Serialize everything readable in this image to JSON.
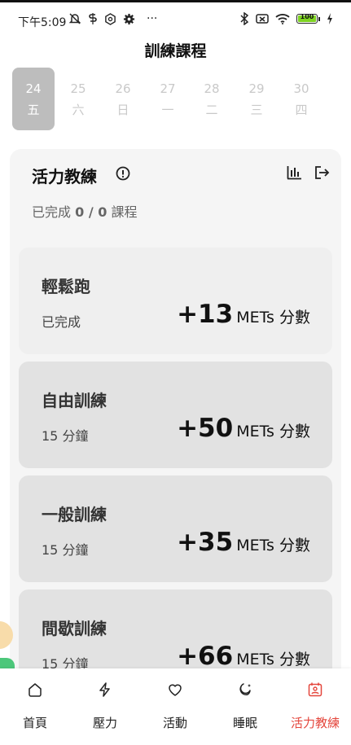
{
  "status_bar": {
    "time": "下午5:09",
    "more": "···",
    "battery_level": "100",
    "left_icons": [
      "mute-icon",
      "s-shield-icon",
      "vpn-icon",
      "gear-icon"
    ],
    "right_icons": [
      "bluetooth-icon",
      "sim-off-icon",
      "wifi-icon",
      "battery-icon",
      "charging-icon"
    ]
  },
  "header": {
    "title": "訓練課程"
  },
  "date_strip": [
    {
      "num": "24",
      "day": "五",
      "selected": true
    },
    {
      "num": "25",
      "day": "六",
      "selected": false
    },
    {
      "num": "26",
      "day": "日",
      "selected": false
    },
    {
      "num": "27",
      "day": "一",
      "selected": false
    },
    {
      "num": "28",
      "day": "二",
      "selected": false
    },
    {
      "num": "29",
      "day": "三",
      "selected": false
    },
    {
      "num": "30",
      "day": "四",
      "selected": false
    }
  ],
  "coach": {
    "title": "活力教練",
    "progress_prefix": "已完成",
    "progress_value": "0 / 0",
    "progress_suffix": "課程"
  },
  "courses": [
    {
      "name": "輕鬆跑",
      "sub": "已完成",
      "points": "+13",
      "unit": "METs 分數",
      "state": "done"
    },
    {
      "name": "自由訓練",
      "sub": "15 分鐘",
      "points": "+50",
      "unit": "METs 分數",
      "state": "todo"
    },
    {
      "name": "一般訓練",
      "sub": "15 分鐘",
      "points": "+35",
      "unit": "METs 分數",
      "state": "todo"
    },
    {
      "name": "間歇訓練",
      "sub": "15 分鐘",
      "points": "+66",
      "unit": "METs 分數",
      "state": "todo"
    }
  ],
  "nav": [
    {
      "label": "首頁",
      "icon": "home-icon",
      "active": false
    },
    {
      "label": "壓力",
      "icon": "bolt-icon",
      "active": false
    },
    {
      "label": "活動",
      "icon": "heart-icon",
      "active": false
    },
    {
      "label": "睡眠",
      "icon": "moon-icon",
      "active": false
    },
    {
      "label": "活力教練",
      "icon": "coach-icon",
      "active": true
    }
  ],
  "colors": {
    "accent": "#e4463c",
    "selected_date": "#bdbdbd",
    "panel": "#f5f5f5"
  }
}
